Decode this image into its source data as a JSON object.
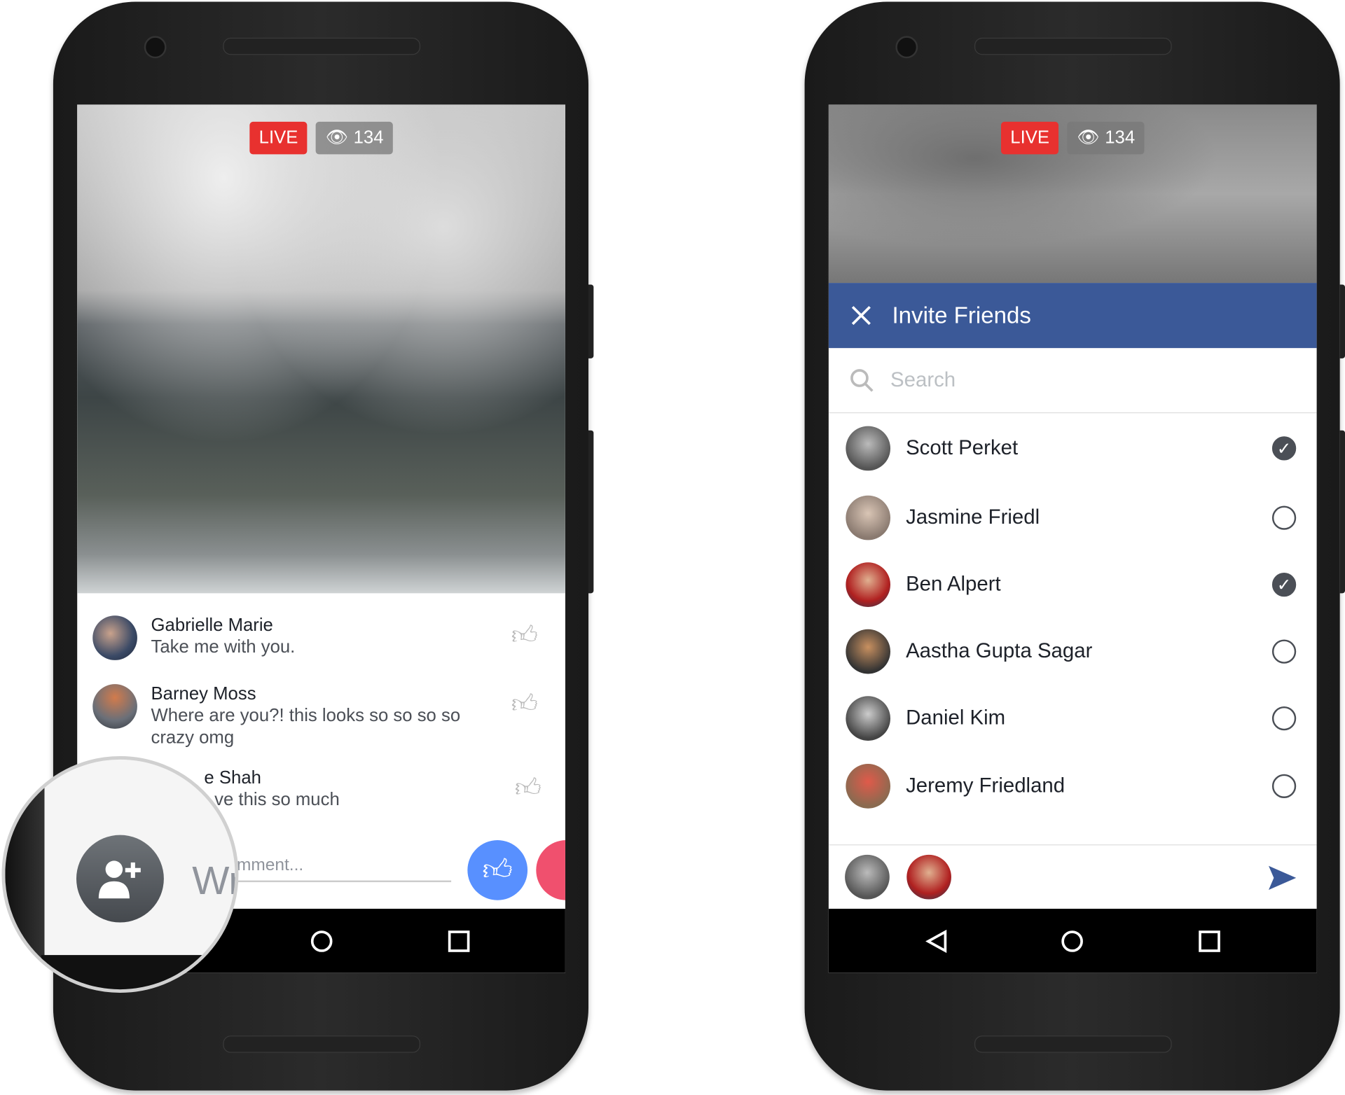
{
  "colors": {
    "live": "#e8312f",
    "header": "#3b5998",
    "like": "#5890ff",
    "love": "#f0506e"
  },
  "left": {
    "live_label": "LIVE",
    "viewer_count": "134",
    "comments": [
      {
        "name": "Gabrielle Marie",
        "text": "Take me with you."
      },
      {
        "name": "Barney Moss",
        "text": "Where are you?! this looks so so so so crazy omg"
      },
      {
        "name": "e Shah",
        "text": "ve this so much"
      }
    ],
    "comment_placeholder": "mment...",
    "magnified_placeholder": "Wr",
    "icons": [
      "eye-icon",
      "thumbs-up-outline-icon",
      "add-friend-icon",
      "like-reaction-icon",
      "love-reaction-icon",
      "home-icon",
      "recents-icon"
    ]
  },
  "right": {
    "live_label": "LIVE",
    "viewer_count": "134",
    "header_title": "Invite Friends",
    "search_placeholder": "Search",
    "friends": [
      {
        "name": "Scott Perket",
        "selected": true
      },
      {
        "name": "Jasmine Friedl",
        "selected": false
      },
      {
        "name": "Ben Alpert",
        "selected": true
      },
      {
        "name": "Aastha Gupta Sagar",
        "selected": false
      },
      {
        "name": "Daniel Kim",
        "selected": false
      },
      {
        "name": "Jeremy Friedland",
        "selected": false
      }
    ],
    "icons": [
      "close-icon",
      "search-icon",
      "send-icon",
      "back-icon",
      "home-icon",
      "recents-icon"
    ]
  }
}
